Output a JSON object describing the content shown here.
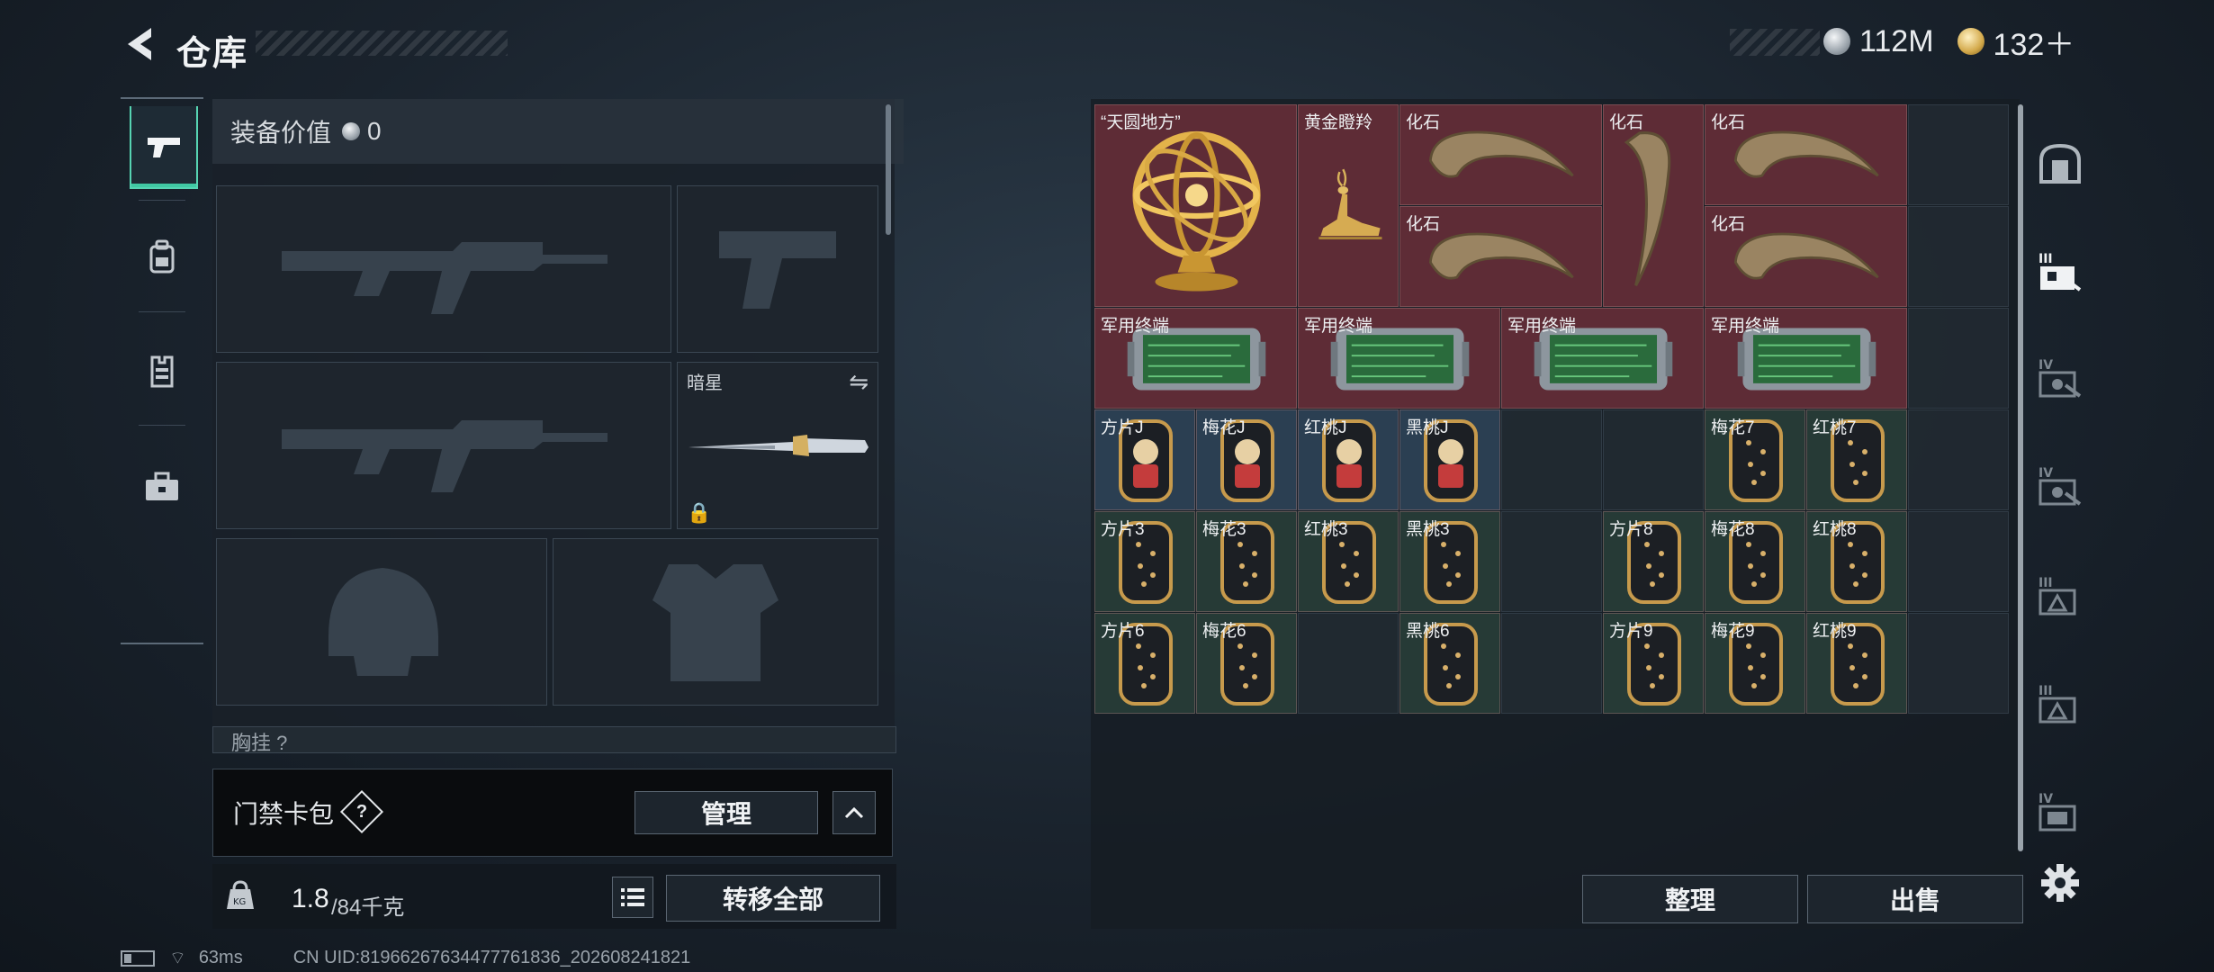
{
  "header": {
    "title": "仓库",
    "currency": [
      {
        "icon": "silver-coin-icon",
        "value": "112M"
      },
      {
        "icon": "gold-coin-icon",
        "value": "132＋"
      }
    ]
  },
  "nav": {
    "items": [
      {
        "icon": "pistol-icon",
        "active": true
      },
      {
        "icon": "backpack-icon",
        "active": false
      },
      {
        "icon": "vest-icon",
        "active": false
      },
      {
        "icon": "toolbox-icon",
        "active": false
      }
    ]
  },
  "equipment": {
    "value_label": "装备价值",
    "value": "0",
    "melee_name": "暗星",
    "chest_peek": "胸挂 ?"
  },
  "keycard": {
    "label": "门禁卡包",
    "help": "?",
    "manage": "管理"
  },
  "footer": {
    "weight_current": "1.8",
    "weight_max": "/84千克",
    "transfer_all": "转移全部"
  },
  "warehouse": {
    "items": [
      {
        "name": "“天圆地方”",
        "icon": "armillary-sphere-icon"
      },
      {
        "name": "黄金瞪羚",
        "icon": "golden-gazelle-icon"
      },
      {
        "name": "化石",
        "icon": "fossil-claw-icon"
      },
      {
        "name": "化石",
        "icon": "fossil-claw-icon"
      },
      {
        "name": "化石",
        "icon": "fossil-claw-icon"
      },
      {
        "name": "化石",
        "icon": "fossil-claw-icon"
      },
      {
        "name": "化石",
        "icon": "fossil-claw-icon"
      },
      {
        "name": "军用终端",
        "icon": "military-terminal-icon"
      },
      {
        "name": "军用终端",
        "icon": "military-terminal-icon"
      },
      {
        "name": "军用终端",
        "icon": "military-terminal-icon"
      },
      {
        "name": "军用终端",
        "icon": "military-terminal-icon"
      },
      {
        "name": "方片J",
        "icon": "card-icon"
      },
      {
        "name": "梅花J",
        "icon": "card-icon"
      },
      {
        "name": "红桃J",
        "icon": "card-icon"
      },
      {
        "name": "黑桃J",
        "icon": "card-icon"
      },
      {
        "name": "梅花7",
        "icon": "card-icon"
      },
      {
        "name": "红桃7",
        "icon": "card-icon"
      },
      {
        "name": "方片3",
        "icon": "card-icon"
      },
      {
        "name": "梅花3",
        "icon": "card-icon"
      },
      {
        "name": "红桃3",
        "icon": "card-icon"
      },
      {
        "name": "黑桃3",
        "icon": "card-icon"
      },
      {
        "name": "方片8",
        "icon": "card-icon"
      },
      {
        "name": "梅花8",
        "icon": "card-icon"
      },
      {
        "name": "红桃8",
        "icon": "card-icon"
      },
      {
        "name": "方片6",
        "icon": "card-icon"
      },
      {
        "name": "梅花6",
        "icon": "card-icon"
      },
      {
        "name": "黑桃6",
        "icon": "card-icon"
      },
      {
        "name": "方片9",
        "icon": "card-icon"
      },
      {
        "name": "梅花9",
        "icon": "card-icon"
      },
      {
        "name": "红桃9",
        "icon": "card-icon"
      }
    ],
    "sort": "整理",
    "sell": "出售"
  },
  "rail": {
    "items": [
      {
        "icon": "vault-icon",
        "tag": ""
      },
      {
        "icon": "shelf-icon",
        "tag": "III"
      },
      {
        "icon": "shelf-icon",
        "tag": "IV"
      },
      {
        "icon": "shelf-icon",
        "tag": "IV"
      },
      {
        "icon": "shelf-icon",
        "tag": "III"
      },
      {
        "icon": "shelf-icon",
        "tag": "III"
      },
      {
        "icon": "shelf-icon",
        "tag": "IV"
      }
    ],
    "settings_icon": "gear-icon"
  },
  "status": {
    "ping": "63ms",
    "uid": "CN UID:81966267634477761836_202608241821"
  },
  "colors": {
    "accent": "#40c8a3",
    "item_red": "#5e2c36",
    "item_blue": "#2b3f52",
    "item_green": "#263a36"
  }
}
